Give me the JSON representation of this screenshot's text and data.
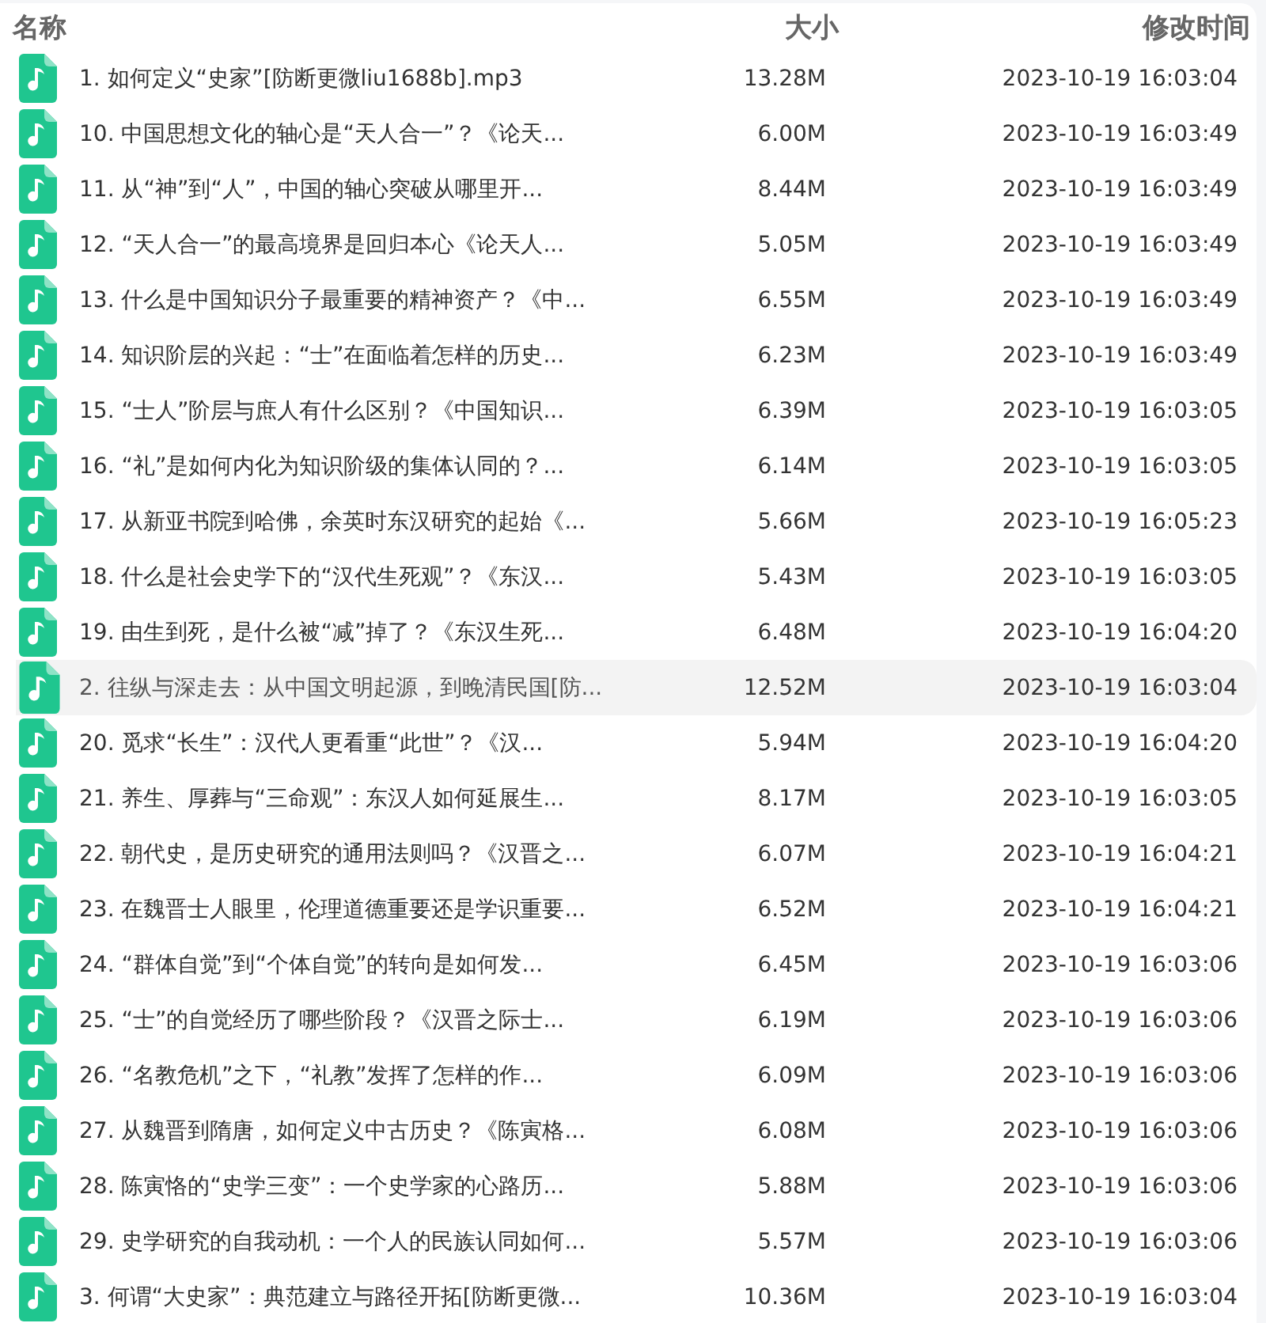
{
  "columns": [
    "名称",
    "大小",
    "修改时间"
  ],
  "files": [
    {
      "name": "1. 如何定义“史家”[防断更微liu1688b].mp3",
      "size": "13.28M",
      "modified": "2023-10-19 16:03:04",
      "selected": false
    },
    {
      "name": "10. 中国思想文化的轴心是“天人合一”？《论天...",
      "size": "6.00M",
      "modified": "2023-10-19 16:03:49",
      "selected": false
    },
    {
      "name": "11. 从“神”到“人”，中国的轴心突破从哪里开...",
      "size": "8.44M",
      "modified": "2023-10-19 16:03:49",
      "selected": false
    },
    {
      "name": "12. “天人合一”的最高境界是回归本心《论天人...",
      "size": "5.05M",
      "modified": "2023-10-19 16:03:49",
      "selected": false
    },
    {
      "name": "13. 什么是中国知识分子最重要的精神资产？《中...",
      "size": "6.55M",
      "modified": "2023-10-19 16:03:49",
      "selected": false
    },
    {
      "name": "14. 知识阶层的兴起：“士”在面临着怎样的历史...",
      "size": "6.23M",
      "modified": "2023-10-19 16:03:49",
      "selected": false
    },
    {
      "name": "15. “士人”阶层与庶人有什么区别？《中国知识...",
      "size": "6.39M",
      "modified": "2023-10-19 16:03:05",
      "selected": false
    },
    {
      "name": "16. “礼”是如何内化为知识阶级的集体认同的？...",
      "size": "6.14M",
      "modified": "2023-10-19 16:03:05",
      "selected": false
    },
    {
      "name": "17. 从新亚书院到哈佛，余英时东汉研究的起始《...",
      "size": "5.66M",
      "modified": "2023-10-19 16:05:23",
      "selected": false
    },
    {
      "name": "18. 什么是社会史学下的“汉代生死观”？《东汉...",
      "size": "5.43M",
      "modified": "2023-10-19 16:03:05",
      "selected": false
    },
    {
      "name": "19. 由生到死，是什么被“减”掉了？《东汉生死...",
      "size": "6.48M",
      "modified": "2023-10-19 16:04:20",
      "selected": false
    },
    {
      "name": "2. 往纵与深走去：从中国文明起源，到晚清民国[防...",
      "size": "12.52M",
      "modified": "2023-10-19 16:03:04",
      "selected": true
    },
    {
      "name": "20. 觅求“长生”：汉代人更看重“此世”？《汉...",
      "size": "5.94M",
      "modified": "2023-10-19 16:04:20",
      "selected": false
    },
    {
      "name": "21. 养生、厚葬与“三命观”：东汉人如何延展生...",
      "size": "8.17M",
      "modified": "2023-10-19 16:03:05",
      "selected": false
    },
    {
      "name": "22. 朝代史，是历史研究的通用法则吗？《汉晋之...",
      "size": "6.07M",
      "modified": "2023-10-19 16:04:21",
      "selected": false
    },
    {
      "name": "23. 在魏晋士人眼里，伦理道德重要还是学识重要...",
      "size": "6.52M",
      "modified": "2023-10-19 16:04:21",
      "selected": false
    },
    {
      "name": "24. “群体自觉”到“个体自觉”的转向是如何发...",
      "size": "6.45M",
      "modified": "2023-10-19 16:03:06",
      "selected": false
    },
    {
      "name": "25. “士”的自觉经历了哪些阶段？《汉晋之际士...",
      "size": "6.19M",
      "modified": "2023-10-19 16:03:06",
      "selected": false
    },
    {
      "name": "26. “名教危机”之下，“礼教”发挥了怎样的作...",
      "size": "6.09M",
      "modified": "2023-10-19 16:03:06",
      "selected": false
    },
    {
      "name": "27. 从魏晋到隋唐，如何定义中古历史？《陈寅格...",
      "size": "6.08M",
      "modified": "2023-10-19 16:03:06",
      "selected": false
    },
    {
      "name": "28. 陈寅恪的“史学三变”：一个史学家的心路历...",
      "size": "5.88M",
      "modified": "2023-10-19 16:03:06",
      "selected": false
    },
    {
      "name": "29. 史学研究的自我动机：一个人的民族认同如何...",
      "size": "5.57M",
      "modified": "2023-10-19 16:03:06",
      "selected": false
    },
    {
      "name": "3. 何谓“大史家”：典范建立与路径开拓[防断更微...",
      "size": "10.36M",
      "modified": "2023-10-19 16:03:04",
      "selected": false
    }
  ]
}
